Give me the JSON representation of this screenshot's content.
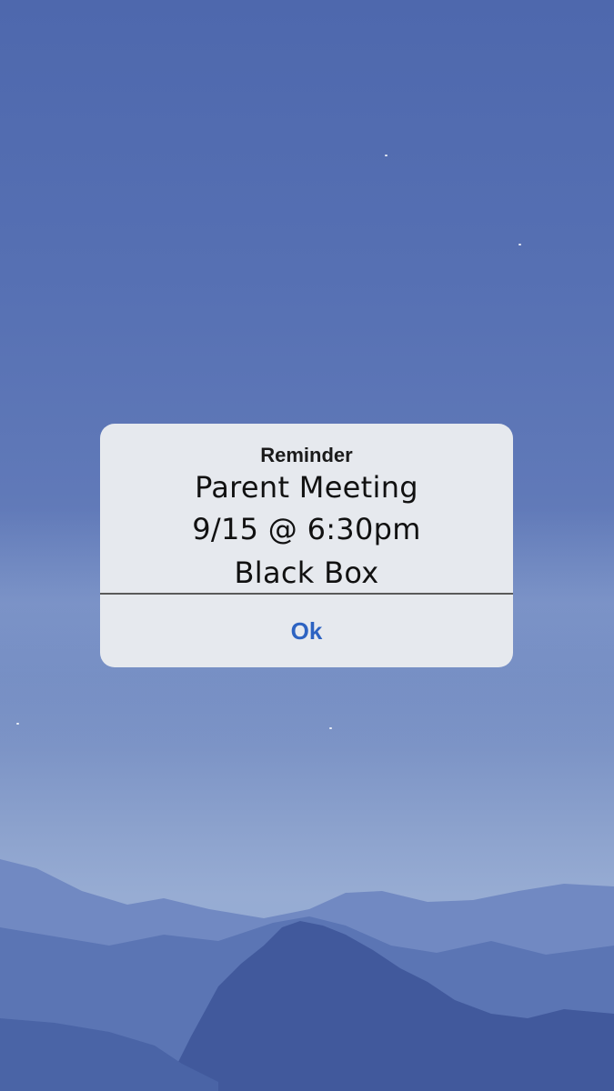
{
  "alert": {
    "title": "Reminder",
    "message_lines": [
      "Parent Meeting",
      "9/15 @ 6:30pm",
      "Black Box"
    ],
    "button_label": "Ok",
    "button_color": "#2d63c2",
    "background_color": "#e6e9ee"
  },
  "wallpaper": {
    "sky_top_color": "#4e68ad",
    "mountain_color": "#3f5a9e"
  }
}
